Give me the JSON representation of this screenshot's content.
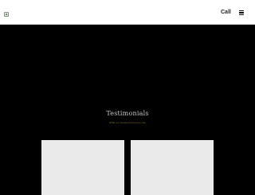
{
  "header": {
    "logo_icon": "broken-image-icon",
    "call_label": "Call",
    "menu_icon": "hamburger-icon"
  },
  "testimonials": {
    "title": "Testimonials",
    "subtitle": "What our customers have to say",
    "cards": [
      {
        "background": "#eaeaea"
      },
      {
        "background": "#eaeaea"
      }
    ]
  },
  "colors": {
    "page_background": "#000000",
    "header_background": "#ffffff",
    "title_text": "#c9c9c9",
    "subtitle_text": "#8a7a2a",
    "card_background": "#eaeaea"
  }
}
